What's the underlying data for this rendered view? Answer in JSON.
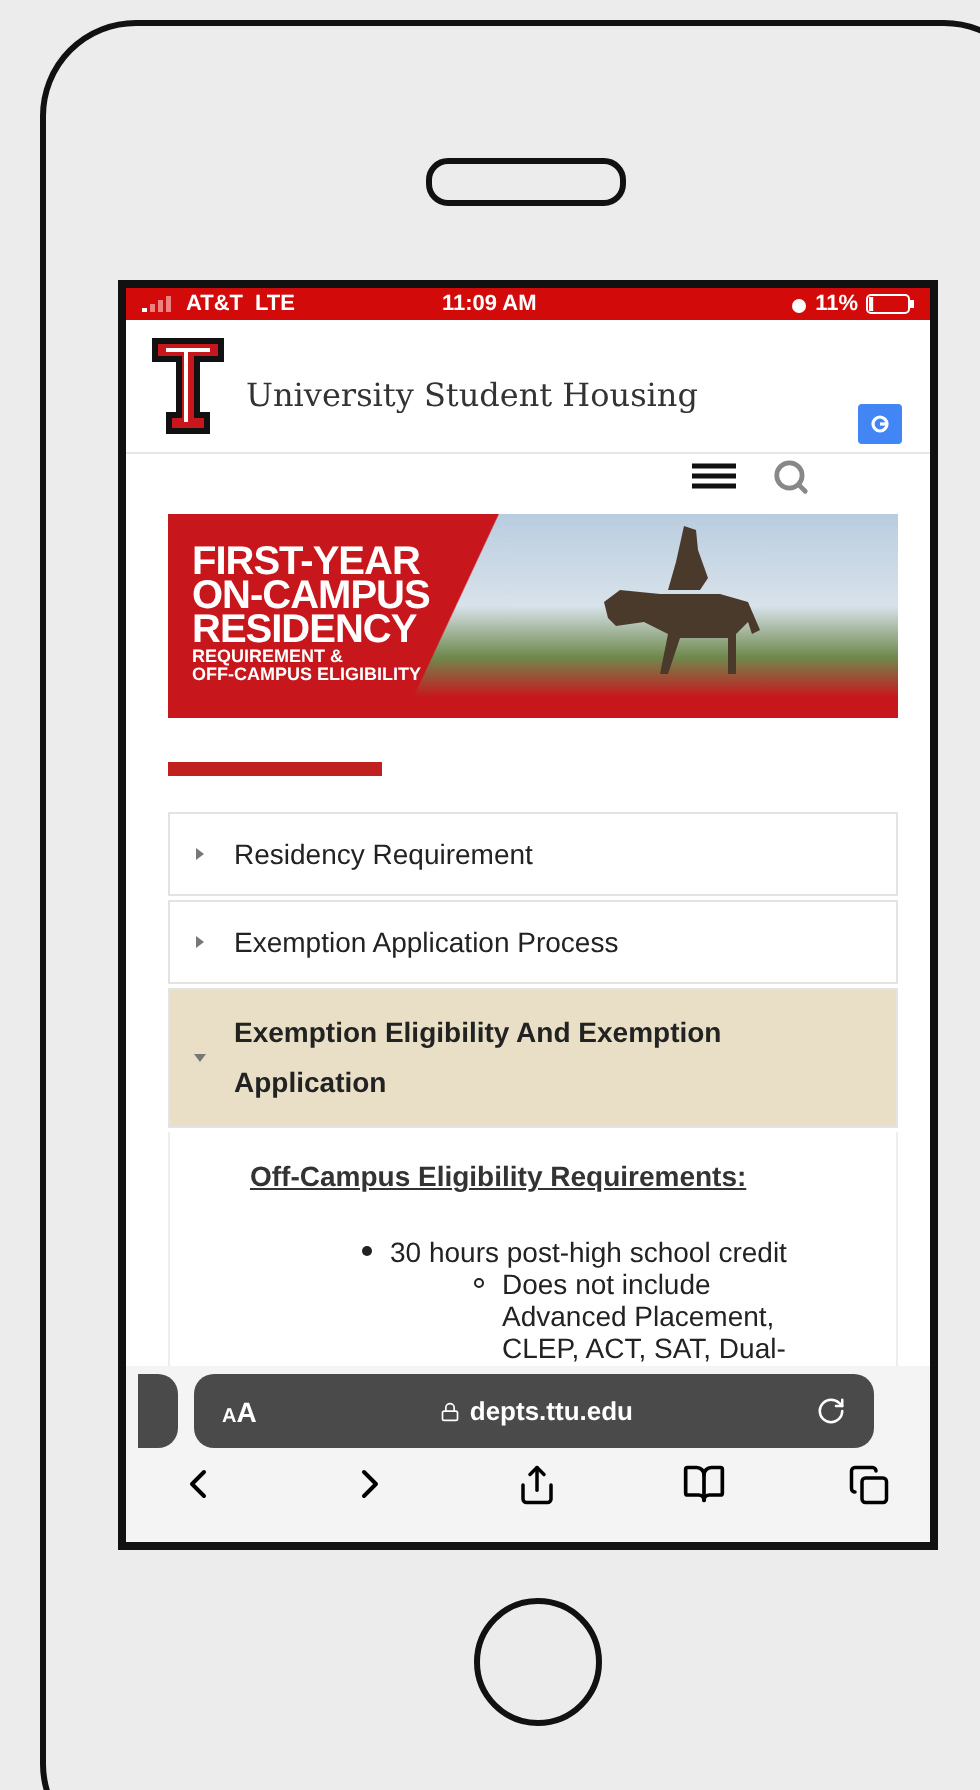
{
  "status_bar": {
    "carrier": "AT&T",
    "network": "LTE",
    "time": "11:09 AM",
    "battery": "11%",
    "level": 0.11
  },
  "header": {
    "title": "University Student Housing"
  },
  "banner": {
    "title_lines": [
      "FIRST-YEAR",
      "ON-CAMPUS",
      "RESIDENCY"
    ],
    "subtitle_lines": [
      "REQUIREMENT &",
      "OFF-CAMPUS ELIGIBILITY"
    ]
  },
  "accordion": [
    {
      "title": "Residency Requirement",
      "expanded": false
    },
    {
      "title": "Exemption Application Process",
      "expanded": false
    },
    {
      "title": "Exemption Eligibility And Exemption Application",
      "expanded": true
    }
  ],
  "content": {
    "heading": "Off-Campus Eligibility Requirements:",
    "list": [
      {
        "text": "30 hours post-high school credit",
        "children": [
          {
            "text": "Does not include Advanced Placement, CLEP, ACT, SAT, Dual-"
          }
        ]
      }
    ]
  },
  "browser": {
    "text_size": "AA",
    "url": "depts.ttu.edu"
  }
}
